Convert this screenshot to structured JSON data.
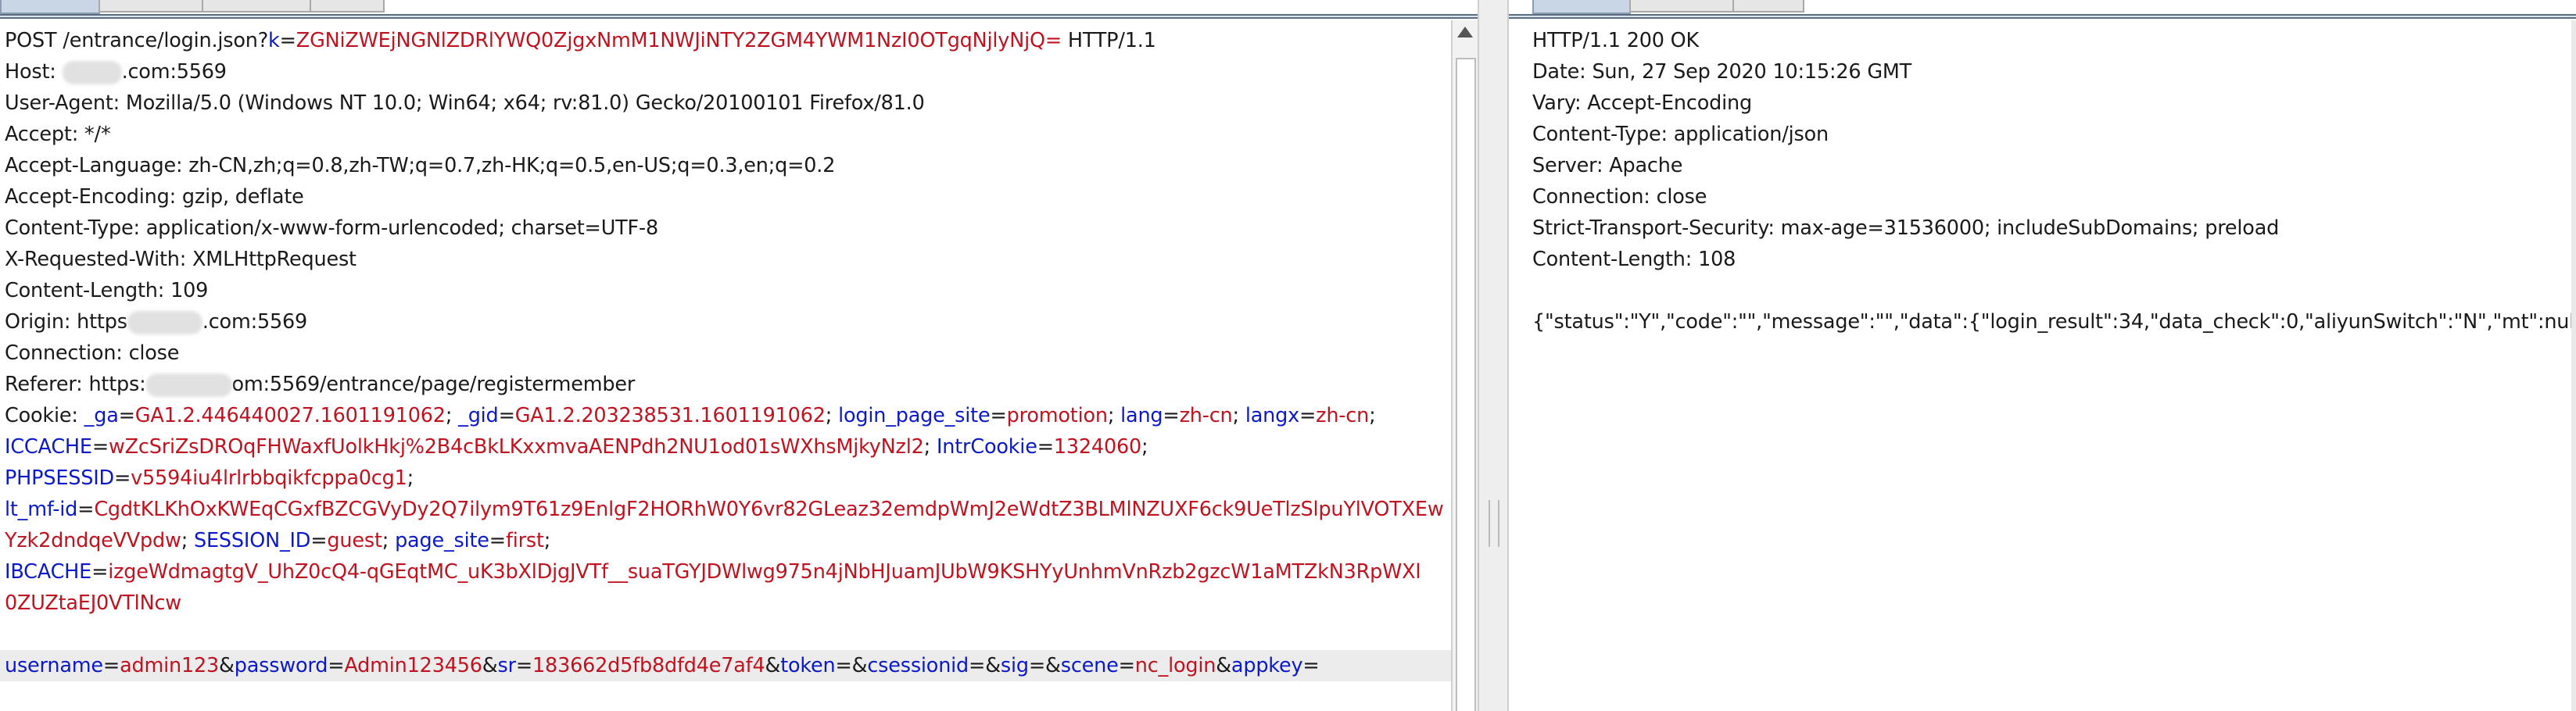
{
  "request": {
    "lines": [
      {
        "kind": "req",
        "method": "POST ",
        "path": "/entrance/login.json",
        "q": "?",
        "pname": "k",
        "eq": "=",
        "pval": "ZGNiZWEjNGNlZDRlYWQ0ZjgxNmM1NWJiNTY2ZGM4YWM1NzI0OTgqNjlyNjQ=",
        "proto": " HTTP/1.1"
      },
      {
        "kind": "host",
        "pre": "Host: ",
        "post": ".com:5569"
      },
      {
        "kind": "plain",
        "text": "User-Agent: Mozilla/5.0 (Windows NT 10.0; Win64; x64; rv:81.0) Gecko/20100101 Firefox/81.0"
      },
      {
        "kind": "plain",
        "text": "Accept: */*"
      },
      {
        "kind": "plain",
        "text": "Accept-Language: zh-CN,zh;q=0.8,zh-TW;q=0.7,zh-HK;q=0.5,en-US;q=0.3,en;q=0.2"
      },
      {
        "kind": "plain",
        "text": "Accept-Encoding: gzip, deflate"
      },
      {
        "kind": "plain",
        "text": "Content-Type: application/x-www-form-urlencoded; charset=UTF-8"
      },
      {
        "kind": "plain",
        "text": "X-Requested-With: XMLHttpRequest"
      },
      {
        "kind": "plain",
        "text": "Content-Length: 109"
      },
      {
        "kind": "origin",
        "pre": "Origin: https",
        "post": ".com:5569"
      },
      {
        "kind": "plain",
        "text": "Connection: close"
      },
      {
        "kind": "referer",
        "pre": "Referer: https:",
        "post": "om:5569/entrance/page/registermember"
      },
      {
        "kind": "params",
        "pre": "Cookie: ",
        "params": [
          {
            "n": "_ga",
            "v": "GA1.2.446440027.1601191062",
            "s": "; "
          },
          {
            "n": "_gid",
            "v": "GA1.2.203238531.1601191062",
            "s": "; "
          },
          {
            "n": "login_page_site",
            "v": "promotion",
            "s": "; "
          },
          {
            "n": "lang",
            "v": "zh-cn",
            "s": "; "
          },
          {
            "n": "langx",
            "v": "zh-cn",
            "s": ";"
          }
        ]
      },
      {
        "kind": "params",
        "pre": "",
        "params": [
          {
            "n": "ICCACHE",
            "v": "wZcSriZsDROqFHWaxfUolkHkj%2B4cBkLKxxmvaAENPdh2NU1od01sWXhsMjkyNzl2",
            "s": "; "
          },
          {
            "n": "IntrCookie",
            "v": "1324060",
            "s": ";"
          }
        ]
      },
      {
        "kind": "params",
        "pre": "",
        "params": [
          {
            "n": "PHPSESSID",
            "v": "v5594iu4lrlrbbqikfcppa0cg1",
            "s": ";"
          }
        ]
      },
      {
        "kind": "params",
        "pre": "",
        "params": [
          {
            "n": "lt_mf-id",
            "v": "CgdtKLKhOxKWEqCGxfBZCGVyDy2Q7ilym9T61z9EnlgF2HORhW0Y6vr82GLeaz32emdpWmJ2eWdtZ3BLMlNZUXF6ck9UeTlzSlpuYlVOTXEw",
            "s": ""
          }
        ]
      },
      {
        "kind": "params",
        "pre": "",
        "lead": "Yzk2dndqeVVpdw",
        "params": [
          {
            "n": "SESSION_ID",
            "v": "guest",
            "s": "; "
          },
          {
            "n": "page_site",
            "v": "first",
            "s": ";"
          }
        ]
      },
      {
        "kind": "params",
        "pre": "",
        "params": [
          {
            "n": "IBCACHE",
            "v": "izgeWdmagtgV_UhZ0cQ4-qGEqtMC_uK3bXlDjgJVTf__suaTGYJDWlwg975n4jNbHJuamJUbW9KSHYyUnhmVnRzb2gzcW1aMTZkN3RpWXl",
            "s": ""
          }
        ]
      },
      {
        "kind": "valonly",
        "text": "0ZUZtaEJ0VTlNcw"
      },
      {
        "kind": "plain",
        "text": ""
      },
      {
        "kind": "params",
        "pre": "",
        "hl": true,
        "params": [
          {
            "n": "username",
            "v": "admin123",
            "s": "&"
          },
          {
            "n": "password",
            "v": "Admin123456",
            "s": "&"
          },
          {
            "n": "sr",
            "v": "183662d5fb8dfd4e7af4",
            "s": "&"
          },
          {
            "n": "token",
            "v": "",
            "s": "&"
          },
          {
            "n": "csessionid",
            "v": "",
            "s": "&"
          },
          {
            "n": "sig",
            "v": "",
            "s": "&"
          },
          {
            "n": "scene",
            "v": "nc_login",
            "s": "&"
          },
          {
            "n": "appkey",
            "v": "",
            "s": ""
          }
        ]
      }
    ]
  },
  "response": {
    "lines": [
      "HTTP/1.1 200 OK",
      "Date: Sun, 27 Sep 2020 10:15:26 GMT",
      "Vary: Accept-Encoding",
      "Content-Type: application/json",
      "Server: Apache",
      "Connection: close",
      "Strict-Transport-Security: max-age=31536000; includeSubDomains; preload",
      "Content-Length: 108",
      "",
      "{\"status\":\"Y\",\"code\":\"\",\"message\":\"\",\"data\":{\"login_result\":34,\"data_check\":0,\"aliyunSwitch\":\"N\",\"mt\":null}}"
    ]
  }
}
